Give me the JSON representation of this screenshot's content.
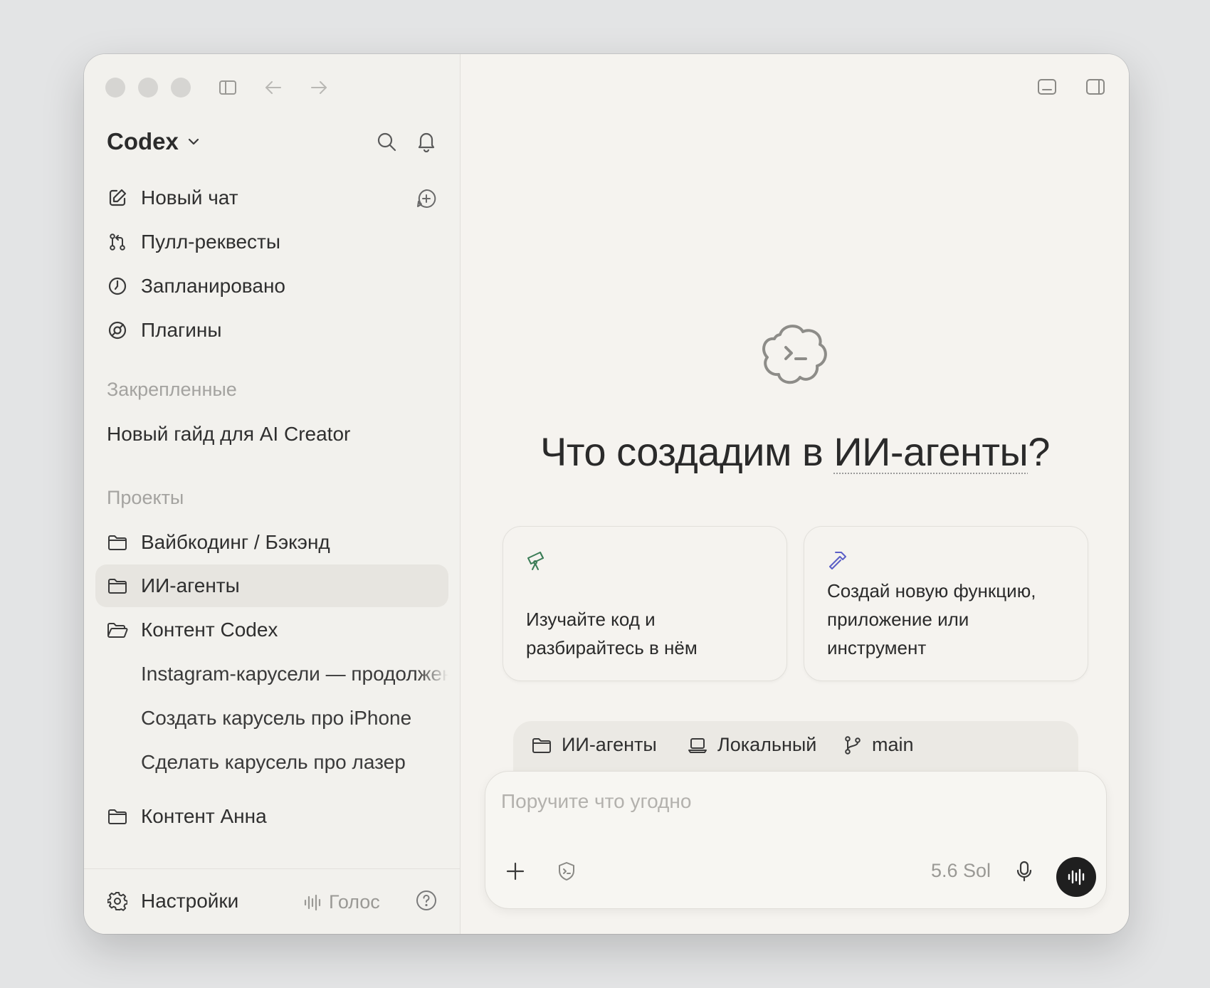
{
  "app": {
    "name": "Codex"
  },
  "nav": {
    "new_chat": "Новый чат",
    "pull_requests": "Пулл-реквесты",
    "scheduled": "Запланировано",
    "plugins": "Плагины"
  },
  "pinned": {
    "title": "Закрепленные",
    "items": [
      "Новый гайд для AI Creator"
    ]
  },
  "projects": {
    "title": "Проекты",
    "items": [
      {
        "label": "Вайбкодинг / Бэкэнд"
      },
      {
        "label": "ИИ-агенты",
        "selected": true
      },
      {
        "label": "Контент Codex",
        "open": true,
        "children": [
          "Instagram-карусели — продолжение",
          "Создать карусель про iPhone",
          "Сделать карусель про лазер"
        ]
      },
      {
        "label": "Контент Анна"
      }
    ]
  },
  "footer": {
    "settings": "Настройки",
    "voice": "Голос"
  },
  "main": {
    "heading_prefix": "Что создадим в ",
    "heading_project": "ИИ-агенты",
    "heading_suffix": "?",
    "cards": [
      {
        "icon": "telescope-icon",
        "text_line1": "Изучайте код и",
        "text_line2": "разбирайтесь в нём",
        "accent": "#3c7d57"
      },
      {
        "icon": "hammer-icon",
        "text_line1": "Создай новую функцию,",
        "text_line2": "приложение или",
        "text_line3": "инструмент",
        "accent": "#5b5fc7"
      }
    ],
    "context": {
      "project": "ИИ-агенты",
      "environment": "Локальный",
      "branch": "main"
    },
    "composer": {
      "placeholder": "Поручите что угодно",
      "model": "5.6 Sol"
    }
  },
  "colors": {
    "window_bg": "#f5f3ef",
    "sidebar_bg": "#f2f1ed",
    "selected_bg": "#e7e5e0",
    "send_button": "#1f1f1f"
  }
}
